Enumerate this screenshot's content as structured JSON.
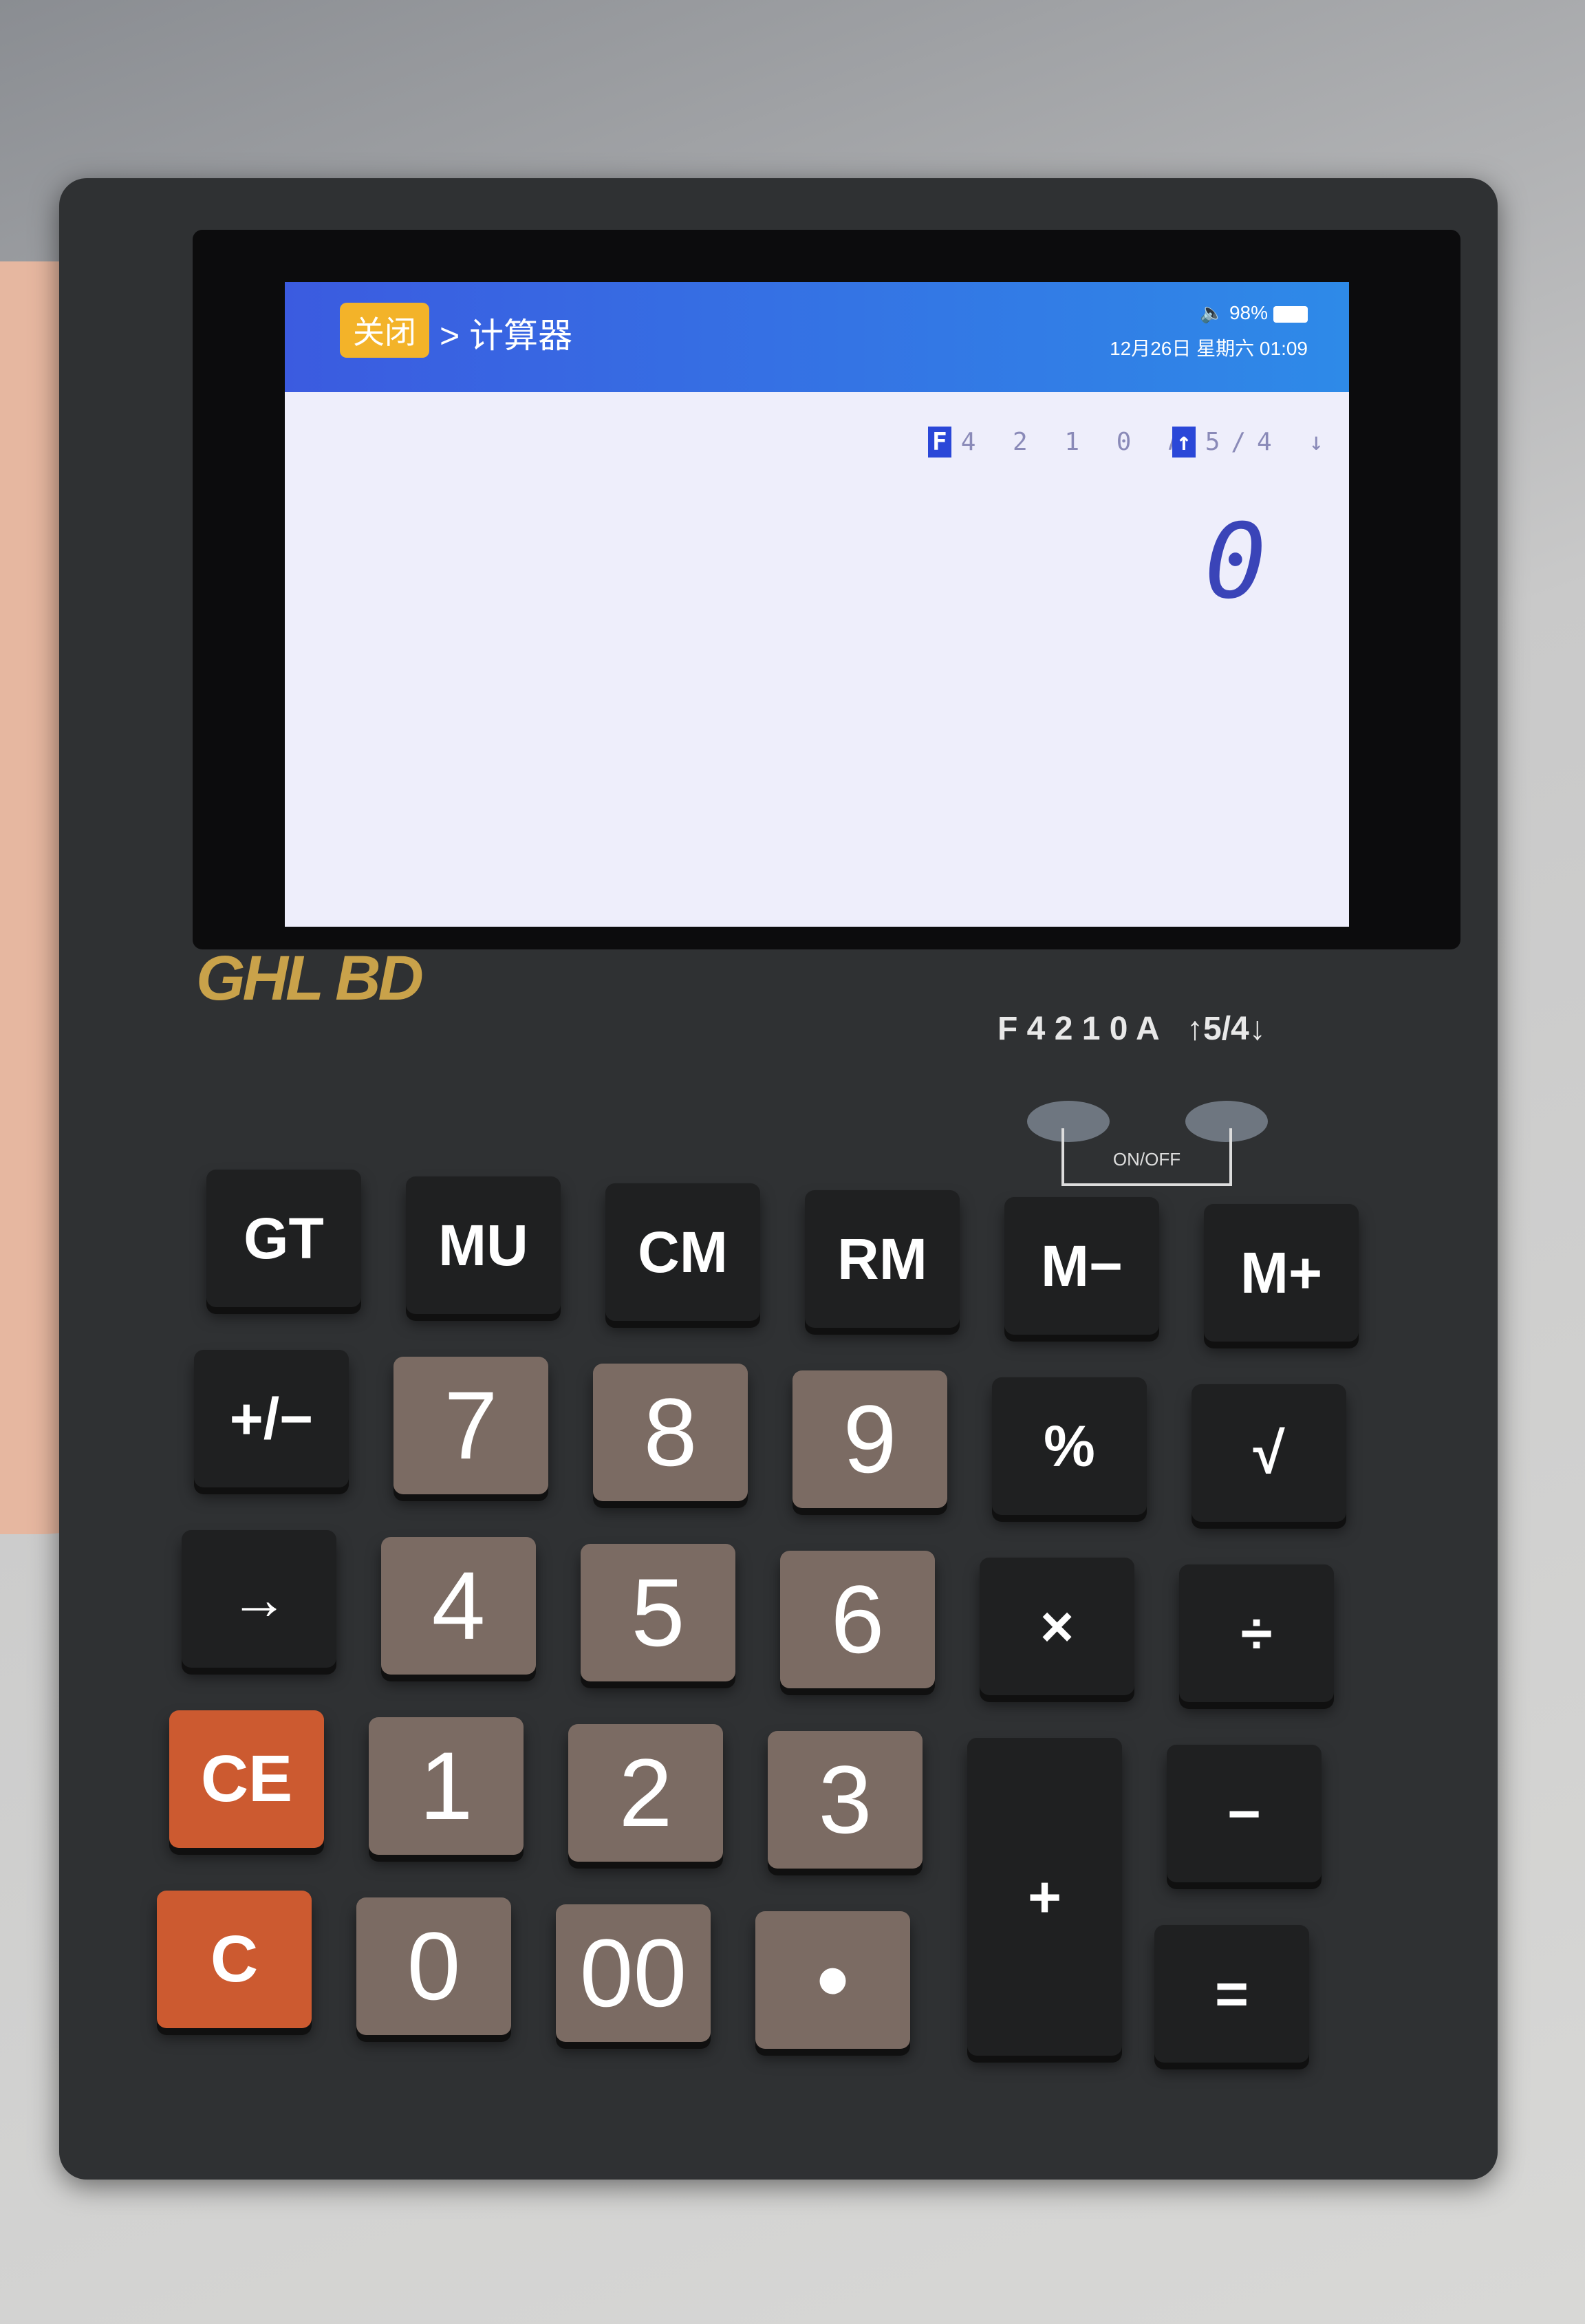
{
  "screen": {
    "close_label": "关闭",
    "breadcrumb": "> 计算器",
    "volume_icon": "speaker-icon",
    "battery": "98%",
    "datetime": "12月26日 星期六 01:09",
    "mode_flag": "F",
    "mode_values": "4 2 1 0 A",
    "round_flag": "↑",
    "round_values": "5/4 ↓",
    "display_value": "0",
    "header_color": "#3b5be0",
    "close_color": "#f3b329"
  },
  "device": {
    "brand": "GHL BD",
    "mode_switch": "F 4 2 1 0 A",
    "round_switch": "↑5/4↓",
    "onoff_label": "ON/OFF"
  },
  "keys": [
    {
      "label": "GT",
      "type": "func",
      "name": "gt"
    },
    {
      "label": "MU",
      "type": "func",
      "name": "mu"
    },
    {
      "label": "CM",
      "type": "func",
      "name": "cm"
    },
    {
      "label": "RM",
      "type": "func",
      "name": "rm"
    },
    {
      "label": "M−",
      "type": "func",
      "name": "m-minus"
    },
    {
      "label": "M+",
      "type": "func",
      "name": "m-plus"
    },
    {
      "label": "+/−",
      "type": "func",
      "name": "sign"
    },
    {
      "label": "7",
      "type": "num",
      "name": "7"
    },
    {
      "label": "8",
      "type": "num",
      "name": "8"
    },
    {
      "label": "9",
      "type": "num",
      "name": "9"
    },
    {
      "label": "%",
      "type": "func",
      "name": "percent"
    },
    {
      "label": "√",
      "type": "func",
      "name": "sqrt"
    },
    {
      "label": "→",
      "type": "func",
      "name": "backspace"
    },
    {
      "label": "4",
      "type": "num",
      "name": "4"
    },
    {
      "label": "5",
      "type": "num",
      "name": "5"
    },
    {
      "label": "6",
      "type": "num",
      "name": "6"
    },
    {
      "label": "×",
      "type": "func",
      "name": "multiply"
    },
    {
      "label": "÷",
      "type": "func",
      "name": "divide"
    },
    {
      "label": "CE",
      "type": "clear",
      "name": "ce"
    },
    {
      "label": "1",
      "type": "num",
      "name": "1"
    },
    {
      "label": "2",
      "type": "num",
      "name": "2"
    },
    {
      "label": "3",
      "type": "num",
      "name": "3"
    },
    {
      "label": "+",
      "type": "func",
      "name": "plus"
    },
    {
      "label": "−",
      "type": "func",
      "name": "minus"
    },
    {
      "label": "C",
      "type": "clear",
      "name": "c"
    },
    {
      "label": "0",
      "type": "num",
      "name": "0"
    },
    {
      "label": "00",
      "type": "num",
      "name": "00"
    },
    {
      "label": "•",
      "type": "num",
      "name": "decimal"
    },
    {
      "label": "=",
      "type": "func",
      "name": "equals"
    }
  ]
}
